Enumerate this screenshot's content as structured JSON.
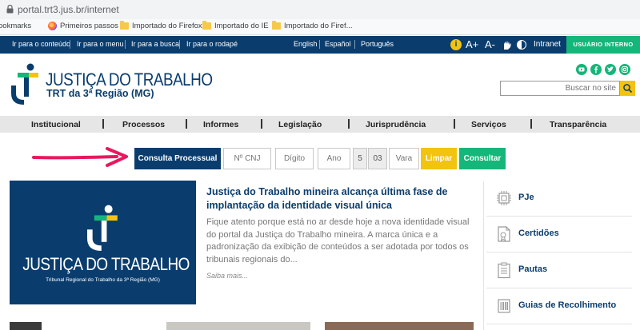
{
  "browser": {
    "url": "portal.trt3.jus.br/internet",
    "bookmarks": [
      {
        "label": "ookmarks"
      },
      {
        "label": "Primeiros passos"
      },
      {
        "label": "Importado do Firefox"
      },
      {
        "label": "Importado do IE"
      },
      {
        "label": "Importado do Firef..."
      }
    ]
  },
  "topbar": {
    "skip_links": [
      "Ir para o conteúdo",
      "Ir para o menu",
      "Ir para a busca",
      "Ir para o rodapé"
    ],
    "languages": [
      "English",
      "Español",
      "Português"
    ],
    "font_increase": "A+",
    "font_decrease": "A-",
    "info_glyph": "i",
    "intranet": "Intranet",
    "user_button": "USUÁRIO INTERNO"
  },
  "header": {
    "title": "JUSTIÇA DO TRABALHO",
    "subtitle": "TRT da 3ª Região (MG)",
    "search_placeholder": "Buscar no site",
    "social_icons": [
      "youtube-icon",
      "facebook-icon",
      "twitter-icon",
      "instagram-icon"
    ]
  },
  "nav": {
    "items": [
      "Institucional",
      "Processos",
      "Informes",
      "Legislação",
      "Jurisprudência",
      "Serviços",
      "Transparência"
    ]
  },
  "consulta": {
    "label": "Consulta Processual",
    "cnj_placeholder": "Nº CNJ",
    "digito_placeholder": "Dígito",
    "ano_placeholder": "Ano",
    "justica": "5",
    "tribunal": "03",
    "vara_placeholder": "Vara",
    "limpar": "Limpar",
    "consultar": "Consultar"
  },
  "news": {
    "image_title": "JUSTIÇA DO TRABALHO",
    "image_subtitle": "Tribunal Regional do Trabalho da 3ª Região (MG)",
    "title": "Justiça do Trabalho mineira alcança última fase de implantação da identidade visual única",
    "body": "Fique atento porque está no ar desde hoje a nova identidade visual do portal da Justiça do Trabalho mineira. A marca única e a padronização da exibição de conteúdos a ser adotada por todos os tribunais regionais do...",
    "more": "Saiba mais..."
  },
  "services": [
    {
      "label": "PJe",
      "icon": "chip-icon"
    },
    {
      "label": "Certidões",
      "icon": "certificate-icon"
    },
    {
      "label": "Pautas",
      "icon": "clipboard-icon"
    },
    {
      "label": "Guias de Recolhimento",
      "icon": "barcode-icon"
    }
  ],
  "colors": {
    "navy": "#0a3d6e",
    "green": "#15b679",
    "yellow": "#f2c40f",
    "arrow": "#e8185f"
  }
}
